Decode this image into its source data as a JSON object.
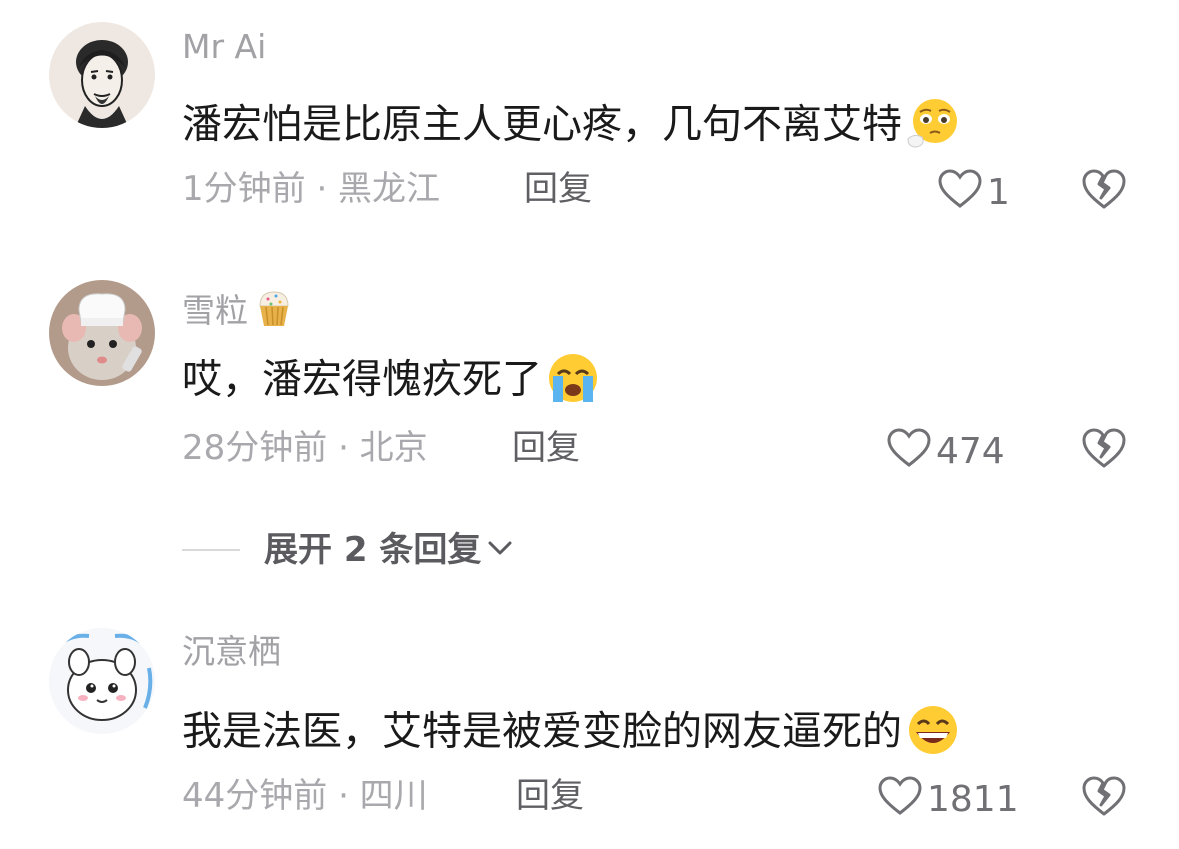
{
  "comments": [
    {
      "username": "Mr Ai",
      "text": "潘宏怕是比原主人更心疼，几句不离艾特",
      "emoji": "pleading-face-icon",
      "time_location": "1分钟前 · 黑龙江",
      "reply_label": "回复",
      "likes": "1"
    },
    {
      "username": "雪粒",
      "username_emoji": "cupcake-icon",
      "text": "哎，潘宏得愧疚死了",
      "emoji": "loudly-crying-face-icon",
      "time_location": "28分钟前 · 北京",
      "reply_label": "回复",
      "likes": "474"
    },
    {
      "username": "沉意栖",
      "text": "我是法医，艾特是被爱变脸的网友逼死的",
      "emoji": "grinning-face-icon",
      "time_location": "44分钟前 · 四川",
      "reply_label": "回复",
      "likes": "1811"
    }
  ],
  "expand_replies": {
    "label": "展开 2 条回复"
  },
  "colors": {
    "username": "#a1a1a6",
    "text": "#1a1a1a",
    "meta": "#a8a8ad",
    "reply": "#5f5f64",
    "icon": "#707075"
  }
}
